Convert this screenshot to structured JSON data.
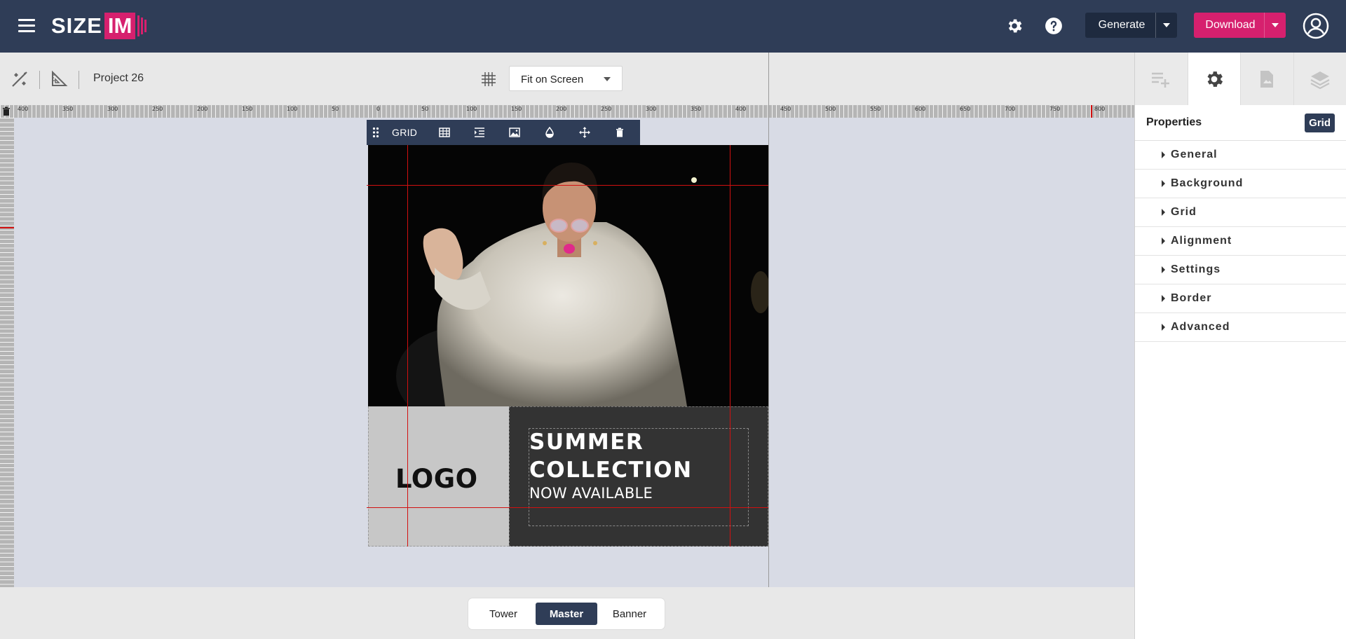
{
  "app": {
    "brand": {
      "name_part1": "SIZE",
      "name_part2": "IM"
    },
    "header": {
      "generate_label": "Generate",
      "download_label": "Download",
      "icons": [
        "menu-icon",
        "gear-icon",
        "help-icon",
        "user-account-icon"
      ]
    },
    "colors": {
      "header_bg": "#2f3d57",
      "accent": "#d6206e",
      "guide": "#d21010"
    }
  },
  "toolbar": {
    "project_name": "Project 26",
    "zoom_select": {
      "value": "Fit on Screen"
    },
    "icons": [
      "magic-tools-icon",
      "ruler-triangle-icon",
      "grid-toggle-icon"
    ]
  },
  "rulers": {
    "top_labels": [
      "400",
      "350",
      "300",
      "250",
      "200",
      "150",
      "100",
      "50",
      "0",
      "50",
      "100",
      "150",
      "200",
      "250",
      "300",
      "350",
      "400",
      "450",
      "500",
      "550",
      "600",
      "650",
      "700",
      "750",
      "800",
      "850"
    ]
  },
  "grid_toolbar": {
    "label": "GRID",
    "icons": [
      "drag-handle-icon",
      "table-icon",
      "indent-icon",
      "image-icon",
      "opacity-drop-icon",
      "move-icon",
      "trash-icon"
    ]
  },
  "banner": {
    "logo_text": "LOGO",
    "headline_line1": "SUMMER",
    "headline_line2": "COLLECTION",
    "subline": "NOW AVAILABLE"
  },
  "bottom_tabs": [
    {
      "label": "Tower",
      "active": false
    },
    {
      "label": "Master",
      "active": true
    },
    {
      "label": "Banner",
      "active": false
    }
  ],
  "right_panel": {
    "tabs": [
      "add-row-icon",
      "gear-icon",
      "document-image-icon",
      "layers-icon"
    ],
    "active_tab": "gear-icon",
    "title": "Properties",
    "badge": "Grid",
    "sections": [
      "General",
      "Background",
      "Grid",
      "Alignment",
      "Settings",
      "Border",
      "Advanced"
    ]
  }
}
